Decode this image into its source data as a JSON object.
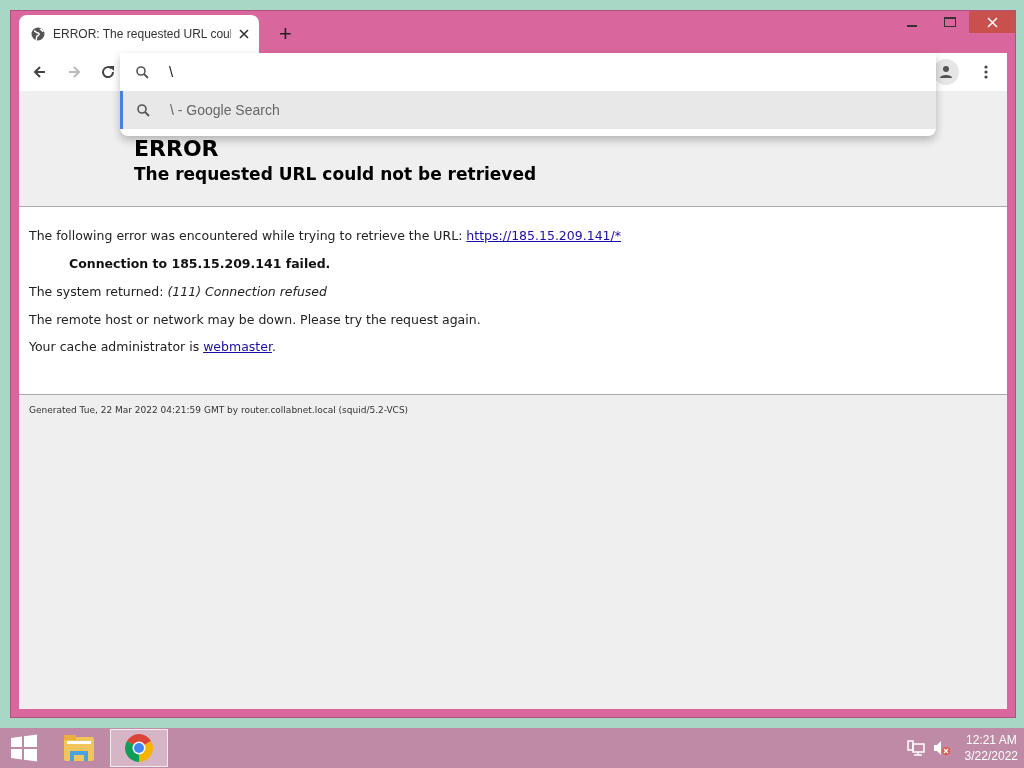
{
  "browser": {
    "tabs": [
      {
        "title": "ERROR: The requested URL coul",
        "selected": true
      }
    ],
    "new_tab": "+",
    "nav_buttons": [
      {
        "kind": "back",
        "disabled": false
      },
      {
        "kind": "forward",
        "disabled": true
      },
      {
        "kind": "reload",
        "disabled": false
      }
    ],
    "omnibox": {
      "value": "\\",
      "suggestions": [
        {
          "text": "\\ - Google Search",
          "selected": true
        }
      ]
    }
  },
  "page": {
    "heading": "ERROR",
    "subheading": "The requested URL could not be retrieved",
    "paragraphs": [
      {
        "kind": "link",
        "text": "The following error was encountered while trying to retrieve the URL:",
        "link": "https://185.15.209.141/*"
      },
      {
        "kind": "bold",
        "text": "Connection to 185.15.209.141 failed."
      },
      {
        "kind": "plain",
        "text": "The system returned: *(111) Connection refused*"
      },
      {
        "kind": "plain",
        "text": "The remote host or network may be down. Please try the request again."
      },
      {
        "kind": "link",
        "text": "Your cache administrator is",
        "link": "webmaster",
        "after": "."
      }
    ],
    "footer": "Generated Tue, 22 Mar 2022 04:21:59 GMT by router.collabnet.local (squid/5.2-VCS)"
  },
  "taskbar": {
    "apps": [
      {
        "kind": "explorer",
        "selected": false
      },
      {
        "kind": "chrome",
        "selected": true
      }
    ],
    "time": "12:21 AM",
    "date": "3/22/2022"
  }
}
